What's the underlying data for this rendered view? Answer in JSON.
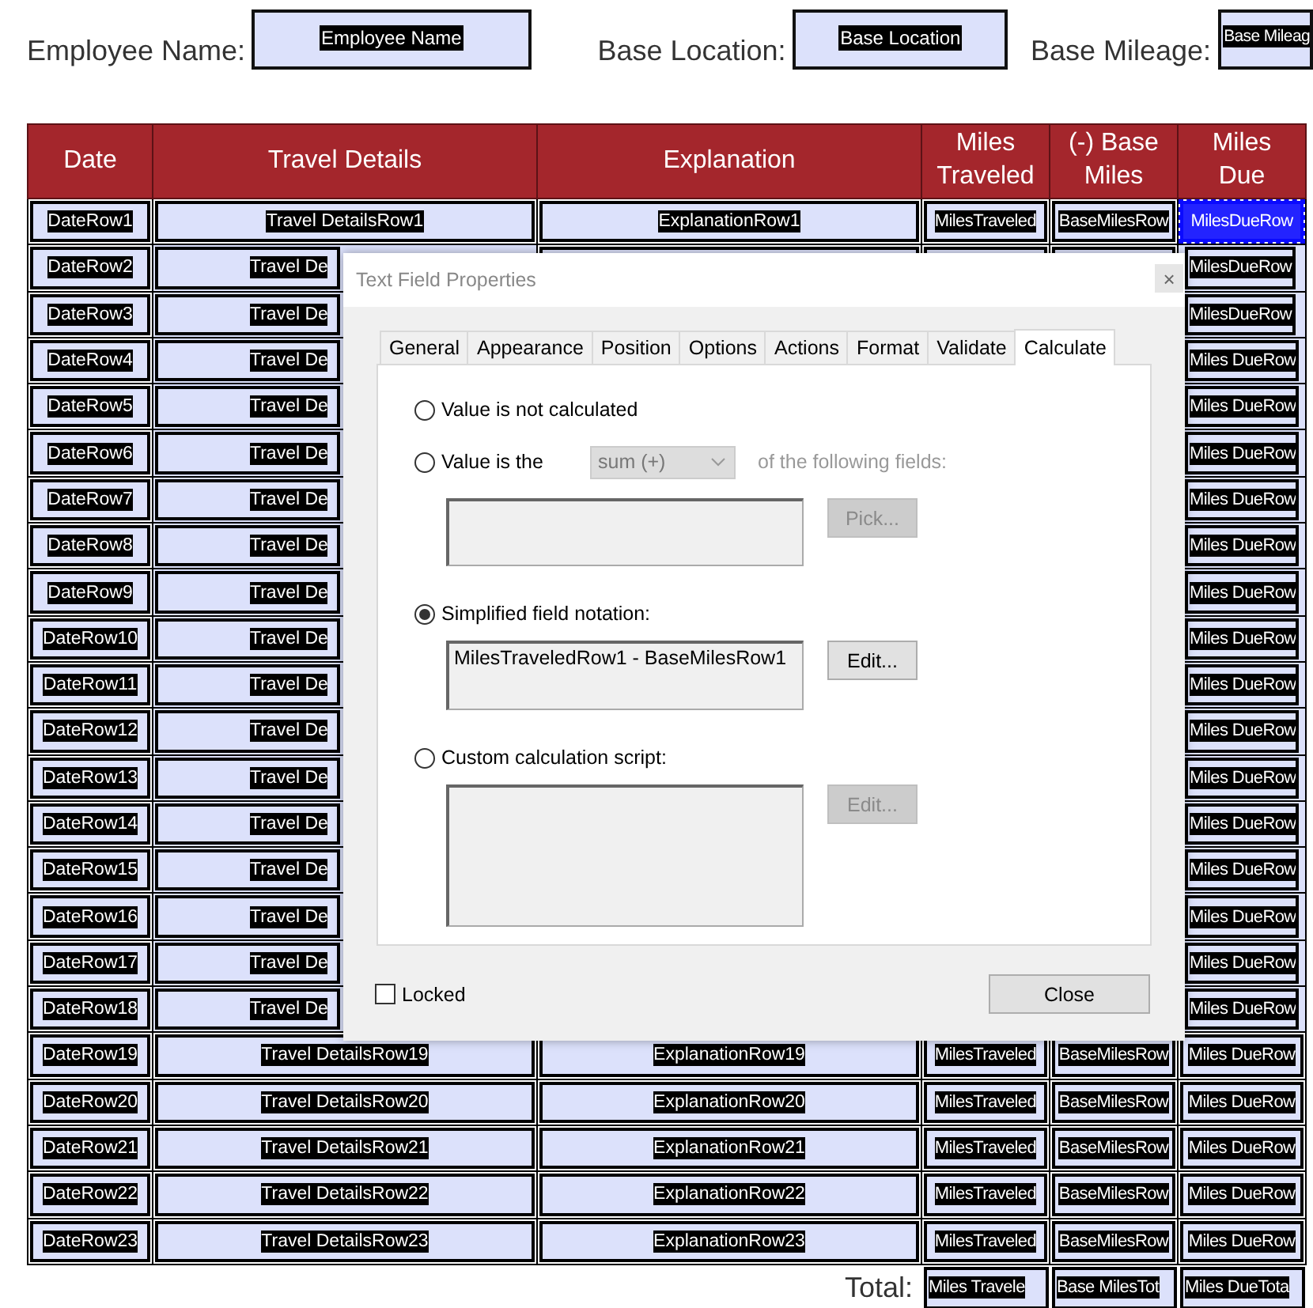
{
  "header_fields": [
    {
      "label": "Employee Name:",
      "value": "Employee Name"
    },
    {
      "label": "Base Location:",
      "value": "Base Location"
    },
    {
      "label": "Base Mileage:",
      "value": "Base Mileag"
    }
  ],
  "table": {
    "columns": [
      "Date",
      "Travel Details",
      "Explanation",
      "Miles Traveled",
      "(-) Base Miles",
      "Miles Due"
    ],
    "rows": [
      {
        "date": "DateRow1",
        "travel_details": "Travel DetailsRow1",
        "explanation": "ExplanationRow1",
        "miles_traveled": "MilesTraveled",
        "base_miles": "BaseMilesRow",
        "miles_due": {
          "text": "MilesDueRow",
          "selected": true
        }
      },
      {
        "date": "DateRow2",
        "travel_details": "Travel De",
        "miles_due": {
          "text": "MilesDueRow",
          "selected": false
        }
      },
      {
        "date": "DateRow3",
        "travel_details": "Travel De",
        "miles_due": {
          "text": "MilesDueRow",
          "selected": false
        }
      },
      {
        "date": "DateRow4",
        "travel_details": "Travel De",
        "miles_due": {
          "text": "Miles DueRow",
          "selected": false
        }
      },
      {
        "date": "DateRow5",
        "travel_details": "Travel De",
        "miles_due": {
          "text": "Miles DueRow",
          "selected": false
        }
      },
      {
        "date": "DateRow6",
        "travel_details": "Travel De",
        "miles_due": {
          "text": "Miles DueRow",
          "selected": false
        }
      },
      {
        "date": "DateRow7",
        "travel_details": "Travel De",
        "miles_due": {
          "text": "Miles DueRow",
          "selected": false
        }
      },
      {
        "date": "DateRow8",
        "travel_details": "Travel De",
        "miles_due": {
          "text": "Miles DueRow",
          "selected": false
        }
      },
      {
        "date": "DateRow9",
        "travel_details": "Travel De",
        "miles_due": {
          "text": "Miles DueRow",
          "selected": false
        }
      },
      {
        "date": "DateRow10",
        "travel_details": "Travel De",
        "miles_due": {
          "text": "Miles DueRow",
          "selected": false
        }
      },
      {
        "date": "DateRow11",
        "travel_details": "Travel De",
        "miles_due": {
          "text": "Miles DueRow",
          "selected": false
        }
      },
      {
        "date": "DateRow12",
        "travel_details": "Travel De",
        "miles_due": {
          "text": "Miles DueRow",
          "selected": false
        }
      },
      {
        "date": "DateRow13",
        "travel_details": "Travel De",
        "miles_due": {
          "text": "Miles DueRow",
          "selected": false
        }
      },
      {
        "date": "DateRow14",
        "travel_details": "Travel De",
        "miles_due": {
          "text": "Miles DueRow",
          "selected": false
        }
      },
      {
        "date": "DateRow15",
        "travel_details": "Travel De",
        "miles_due": {
          "text": "Miles DueRow",
          "selected": false
        }
      },
      {
        "date": "DateRow16",
        "travel_details": "Travel De",
        "miles_due": {
          "text": "Miles DueRow",
          "selected": false
        }
      },
      {
        "date": "DateRow17",
        "travel_details": "Travel De",
        "miles_due": {
          "text": "Miles DueRow",
          "selected": false
        }
      },
      {
        "date": "DateRow18",
        "travel_details": "Travel De",
        "miles_due": {
          "text": "Miles DueRow",
          "selected": false
        }
      },
      {
        "date": "DateRow19",
        "travel_details": "Travel DetailsRow19",
        "explanation": "ExplanationRow19",
        "miles_traveled": "MilesTraveled",
        "base_miles": "BaseMilesRow",
        "miles_due": {
          "text": "Miles DueRow",
          "selected": false
        }
      },
      {
        "date": "DateRow20",
        "travel_details": "Travel DetailsRow20",
        "explanation": "ExplanationRow20",
        "miles_traveled": "MilesTraveled",
        "base_miles": "BaseMilesRow",
        "miles_due": {
          "text": "Miles DueRow",
          "selected": false
        }
      },
      {
        "date": "DateRow21",
        "travel_details": "Travel DetailsRow21",
        "explanation": "ExplanationRow21",
        "miles_traveled": "MilesTraveled",
        "base_miles": "BaseMilesRow",
        "miles_due": {
          "text": "Miles DueRow",
          "selected": false
        }
      },
      {
        "date": "DateRow22",
        "travel_details": "Travel DetailsRow22",
        "explanation": "ExplanationRow22",
        "miles_traveled": "MilesTraveled",
        "base_miles": "BaseMilesRow",
        "miles_due": {
          "text": "Miles DueRow",
          "selected": false
        }
      },
      {
        "date": "DateRow23",
        "travel_details": "Travel DetailsRow23",
        "explanation": "ExplanationRow23",
        "miles_traveled": "MilesTraveled",
        "base_miles": "BaseMilesRow",
        "miles_due": {
          "text": "Miles DueRow",
          "selected": false
        }
      }
    ],
    "total": {
      "label": "Total:",
      "miles_traveled": "Miles Travele",
      "base_miles": "Base MilesTot",
      "miles_due": "Miles DueTota"
    }
  },
  "dialog": {
    "title": "Text Field Properties",
    "close": "×",
    "tabs": [
      {
        "label": "General",
        "selected": false
      },
      {
        "label": "Appearance",
        "selected": false
      },
      {
        "label": "Position",
        "selected": false
      },
      {
        "label": "Options",
        "selected": false
      },
      {
        "label": "Actions",
        "selected": false
      },
      {
        "label": "Format",
        "selected": false
      },
      {
        "label": "Validate",
        "selected": false
      },
      {
        "label": "Calculate",
        "selected": true
      }
    ],
    "options": [
      {
        "kind": "plain",
        "label": "Value is not calculated",
        "selected": false
      },
      {
        "kind": "fields",
        "label": "Value is the",
        "selected": false,
        "operation": "sum (+)",
        "disabled": true,
        "suffix": "of the following fields:",
        "button": "Pick..."
      },
      {
        "kind": "notation",
        "label": "Simplified field notation:",
        "selected": true,
        "value": "MilesTraveledRow1 - BaseMilesRow1",
        "disabled": false,
        "button": "Edit..."
      },
      {
        "kind": "script",
        "label": "Custom calculation script:",
        "selected": false,
        "disabled": true,
        "button": "Edit..."
      }
    ],
    "locked": {
      "label": "Locked",
      "checked": false
    },
    "close_button": "Close"
  }
}
